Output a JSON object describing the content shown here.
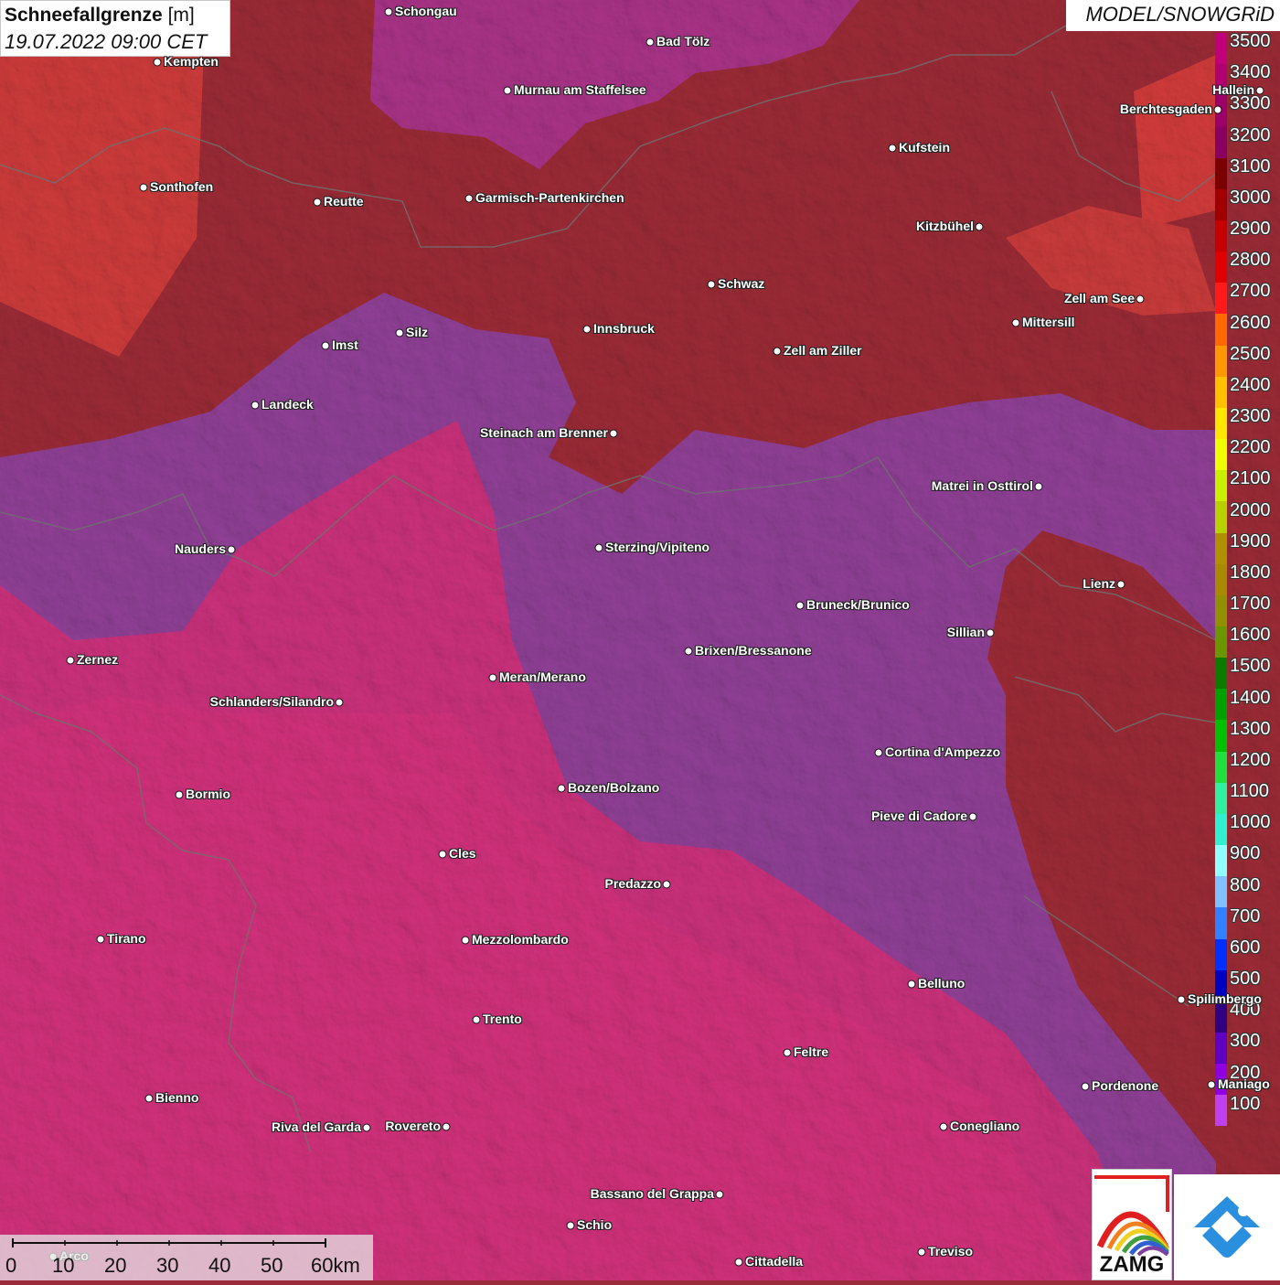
{
  "title": {
    "param": "Schneefallgrenze",
    "unit": "[m]",
    "datetime": "19.07.2022 09:00 CET"
  },
  "model_label": "MODEL/SNOWGRiD",
  "legend": {
    "labels": [
      "3500",
      "3400",
      "3300",
      "3200",
      "3100",
      "3000",
      "2900",
      "2800",
      "2700",
      "2600",
      "2500",
      "2400",
      "2300",
      "2200",
      "2100",
      "2000",
      "1900",
      "1800",
      "1700",
      "1600",
      "1500",
      "1400",
      "1300",
      "1200",
      "1100",
      "1000",
      "900",
      "800",
      "700",
      "600",
      "500",
      "400",
      "300",
      "200",
      "100"
    ],
    "colors": [
      "#c2007a",
      "#b00070",
      "#9c0068",
      "#8a0060",
      "#7a0000",
      "#a00000",
      "#c40000",
      "#e00000",
      "#ff1a1a",
      "#ff6a00",
      "#ff9800",
      "#ffc000",
      "#ffe600",
      "#f0ff00",
      "#c8f000",
      "#b8d000",
      "#b09000",
      "#a88a00",
      "#909000",
      "#6a9600",
      "#0a7a00",
      "#00a000",
      "#00c000",
      "#20e040",
      "#30f0a0",
      "#30f0d0",
      "#90ffff",
      "#80c0ff",
      "#3080ff",
      "#0030ff",
      "#0000c0",
      "#300080",
      "#6000c0",
      "#9000e0",
      "#c040f0"
    ]
  },
  "cities": [
    {
      "name": "Schongau",
      "side": "r"
    },
    {
      "name": "Bad Tölz",
      "side": "r"
    },
    {
      "name": "Kempten",
      "side": "r"
    },
    {
      "name": "Murnau am Staffelsee",
      "side": "r"
    },
    {
      "name": "Hallein",
      "side": "l"
    },
    {
      "name": "Berchtesgaden",
      "side": "l"
    },
    {
      "name": "Kufstein",
      "side": "r"
    },
    {
      "name": "Sonthofen",
      "side": "r"
    },
    {
      "name": "Reutte",
      "side": "r"
    },
    {
      "name": "Garmisch-Partenkirchen",
      "side": "r"
    },
    {
      "name": "Kitzbühel",
      "side": "l"
    },
    {
      "name": "Schwaz",
      "side": "r"
    },
    {
      "name": "Zell am See",
      "side": "l"
    },
    {
      "name": "Innsbruck",
      "side": "r"
    },
    {
      "name": "Mittersill",
      "side": "r"
    },
    {
      "name": "Silz",
      "side": "r"
    },
    {
      "name": "Imst",
      "side": "r"
    },
    {
      "name": "Zell am Ziller",
      "side": "r"
    },
    {
      "name": "Landeck",
      "side": "r"
    },
    {
      "name": "Steinach am Brenner",
      "side": "l"
    },
    {
      "name": "Matrei in Osttirol",
      "side": "l"
    },
    {
      "name": "Nauders",
      "side": "l"
    },
    {
      "name": "Sterzing/Vipiteno",
      "side": "r"
    },
    {
      "name": "Lienz",
      "side": "l"
    },
    {
      "name": "Bruneck/Brunico",
      "side": "r"
    },
    {
      "name": "Sillian",
      "side": "l"
    },
    {
      "name": "Brixen/Bressanone",
      "side": "r"
    },
    {
      "name": "Zernez",
      "side": "r"
    },
    {
      "name": "Meran/Merano",
      "side": "r"
    },
    {
      "name": "Schlanders/Silandro",
      "side": "l"
    },
    {
      "name": "Cortina d'Ampezzo",
      "side": "r"
    },
    {
      "name": "Bozen/Bolzano",
      "side": "r"
    },
    {
      "name": "Bormio",
      "side": "r"
    },
    {
      "name": "Pieve di Cadore",
      "side": "l"
    },
    {
      "name": "Cles",
      "side": "r"
    },
    {
      "name": "Predazzo",
      "side": "l"
    },
    {
      "name": "Tirano",
      "side": "r"
    },
    {
      "name": "Mezzolombardo",
      "side": "r"
    },
    {
      "name": "Belluno",
      "side": "r"
    },
    {
      "name": "Spilimbergo",
      "side": "r"
    },
    {
      "name": "Trento",
      "side": "r"
    },
    {
      "name": "Feltre",
      "side": "r"
    },
    {
      "name": "Pordenone",
      "side": "r"
    },
    {
      "name": "Maniago",
      "side": "r"
    },
    {
      "name": "Bienno",
      "side": "r"
    },
    {
      "name": "Riva del Garda",
      "side": "l"
    },
    {
      "name": "Rovereto",
      "side": "l"
    },
    {
      "name": "Conegliano",
      "side": "r"
    },
    {
      "name": "Bassano del Grappa",
      "side": "l"
    },
    {
      "name": "Schio",
      "side": "r"
    },
    {
      "name": "Treviso",
      "side": "r"
    },
    {
      "name": "Arco",
      "side": "r"
    },
    {
      "name": "Cittadella",
      "side": "r"
    }
  ],
  "scale": {
    "labels": [
      "0",
      "10",
      "20",
      "30",
      "40",
      "50",
      "60km"
    ]
  },
  "logos": {
    "zamg": "ZAMG"
  }
}
